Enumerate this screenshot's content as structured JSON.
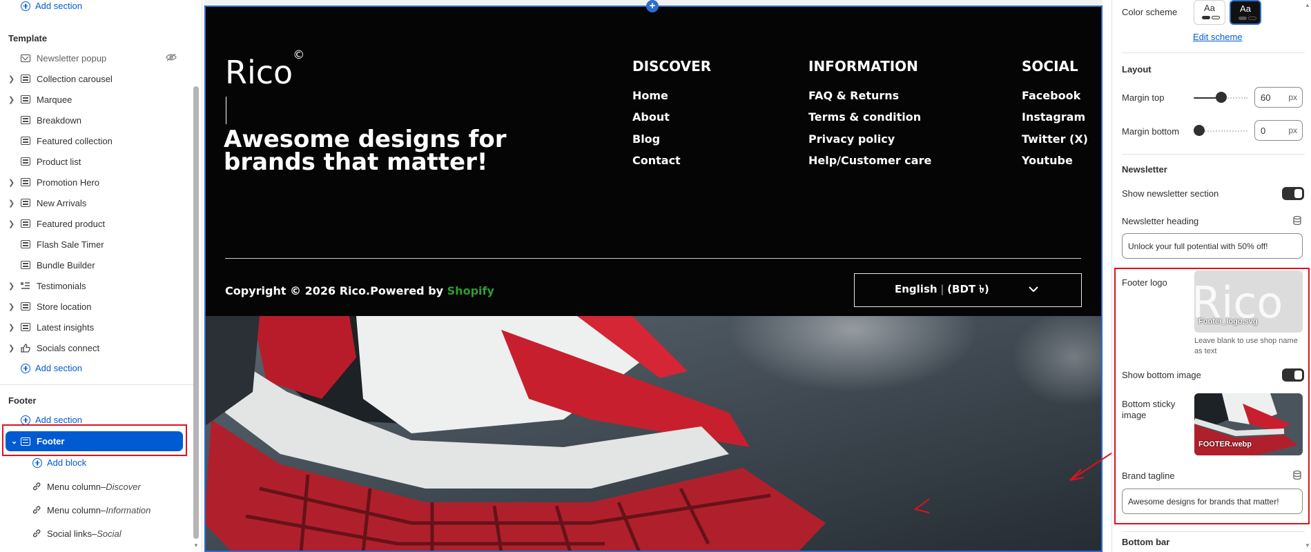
{
  "left": {
    "add_section_top": "Add section",
    "template_title": "Template",
    "template_items": [
      {
        "label": "Newsletter popup",
        "hidden": true
      },
      {
        "label": "Collection carousel"
      },
      {
        "label": "Marquee"
      },
      {
        "label": "Breakdown"
      },
      {
        "label": "Featured collection"
      },
      {
        "label": "Product list"
      },
      {
        "label": "Promotion Hero"
      },
      {
        "label": "New Arrivals"
      },
      {
        "label": "Featured product"
      },
      {
        "label": "Flash Sale Timer"
      },
      {
        "label": "Bundle Builder"
      },
      {
        "label": "Testimonials"
      },
      {
        "label": "Store location"
      },
      {
        "label": "Latest insights"
      },
      {
        "label": "Socials connect"
      }
    ],
    "add_section_template": "Add section",
    "footer_title": "Footer",
    "add_section_footer": "Add section",
    "footer_selected": "Footer",
    "add_block": "Add block",
    "blocks": [
      {
        "label": "Menu column",
        "detail": "Discover"
      },
      {
        "label": "Menu column",
        "detail": "Information"
      },
      {
        "label": "Social links",
        "detail": "Social"
      }
    ],
    "dash": " – "
  },
  "preview": {
    "brand": "Rico",
    "brand_mark": "©",
    "tagline": "Awesome designs for brands that matter!",
    "columns": [
      {
        "heading": "DISCOVER",
        "links": [
          "Home",
          "About",
          "Blog",
          "Contact"
        ]
      },
      {
        "heading": "INFORMATION",
        "links": [
          "FAQ & Returns",
          "Terms & condition",
          "Privacy policy",
          "Help/Customer care"
        ]
      },
      {
        "heading": "SOCIAL",
        "links": [
          "Facebook",
          "Instagram",
          "Twitter (X)",
          "Youtube"
        ]
      }
    ],
    "copyright": "Copyright © 2026 Rico.Powered by ",
    "powered_by": "Shopify",
    "language": "English",
    "lang_sep": " | ",
    "currency": "(BDT ৳)"
  },
  "right": {
    "color_scheme_label": "Color scheme",
    "scheme_aa": "Aa",
    "edit_scheme": "Edit scheme",
    "layout_title": "Layout",
    "margin_top_label": "Margin top",
    "margin_top_value": "60",
    "margin_top_unit": "px",
    "margin_top_level": 0.55,
    "margin_bottom_label": "Margin bottom",
    "margin_bottom_value": "0",
    "margin_bottom_unit": "px",
    "margin_bottom_level": 0,
    "newsletter_title": "Newsletter",
    "show_newsletter_label": "Show newsletter section",
    "newsletter_heading_label": "Newsletter heading",
    "newsletter_heading_value": "Unlock your full potential with 50% off!",
    "footer_logo_label": "Footer logo",
    "footer_logo_file": "Footer_logo.svg",
    "footer_logo_hint": "Leave blank to use shop name as text",
    "show_bottom_image_label": "Show bottom image",
    "bottom_image_label": "Bottom sticky image",
    "bottom_image_file": "FOOTER.webp",
    "brand_tagline_label": "Brand tagline",
    "brand_tagline_value": "Awesome designs for brands that matter!",
    "bottom_bar_title": "Bottom bar"
  },
  "colors": {
    "accent_blue": "#005bd3",
    "annotation_red": "#e0111b",
    "footer_bg": "#050505",
    "shopify_green": "#2f9e2f"
  }
}
